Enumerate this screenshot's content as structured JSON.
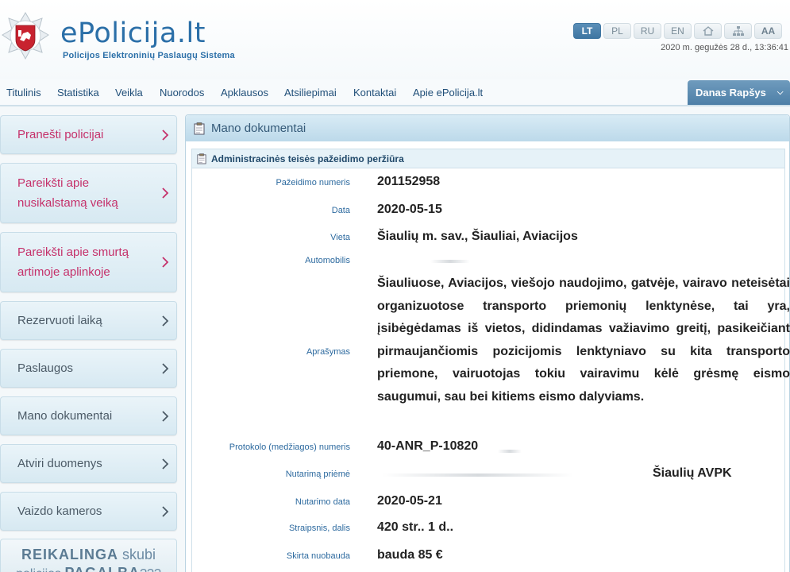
{
  "header": {
    "site_title": "ePolicija.lt",
    "site_subtitle": "Policijos Elektroninių Paslaugų Sistema",
    "languages": [
      "LT",
      "PL",
      "RU",
      "EN"
    ],
    "active_language": "LT",
    "font_size_label": "AA",
    "datetime": "2020 m. gegužės 28 d., 13:36:41"
  },
  "nav": {
    "items": [
      "Titulinis",
      "Statistika",
      "Veikla",
      "Nuorodos",
      "Apklausos",
      "Atsiliepimai",
      "Kontaktai",
      "Apie ePolicija.lt"
    ],
    "user_name": "Danas Rapšys"
  },
  "sidebar": {
    "items": [
      {
        "label_line1": "Pranešti policijai",
        "label_line2": "",
        "style": "pink"
      },
      {
        "label_line1": "Pareikšti apie",
        "label_line2": "nusikalstamą veiką",
        "style": "pink"
      },
      {
        "label_line1": "Pareikšti apie smurtą",
        "label_line2": "artimoje aplinkoje",
        "style": "pink"
      },
      {
        "label_line1": "Rezervuoti laiką",
        "label_line2": "",
        "style": "blue"
      },
      {
        "label_line1": "Paslaugos",
        "label_line2": "",
        "style": "blue"
      },
      {
        "label_line1": "Mano dokumentai",
        "label_line2": "",
        "style": "blue"
      },
      {
        "label_line1": "Atviri duomenys",
        "label_line2": "",
        "style": "blue"
      },
      {
        "label_line1": "Vaizdo kameros",
        "label_line2": "",
        "style": "blue"
      }
    ],
    "help": {
      "line1_bold": "REIKALINGA",
      "line1_rest": " skubi",
      "line2_rest": "policijos ",
      "line2_bold": "PAGALBA",
      "line2_tail": "???"
    }
  },
  "main": {
    "panel_title": "Mano dokumentai",
    "section_title": "Administracinės teisės pažeidimo peržiūra",
    "fields": {
      "violation_number": {
        "label": "Pažeidimo numeris",
        "value": "201152958"
      },
      "date": {
        "label": "Data",
        "value": "2020-05-15"
      },
      "place": {
        "label": "Vieta",
        "value": "Šiaulių m. sav., Šiauliai, Aviacijos"
      },
      "vehicle": {
        "label": "Automobilis",
        "value": ""
      },
      "description": {
        "label": "Aprašymas",
        "value": "Šiauliuose, Aviacijos, viešojo naudojimo, gatvėje, vairavo neteisėtai organizuotose transporto priemonių lenktynėse, tai yra, įsibėgėdamas iš vietos, didindamas važiavimo greitį, pasikeičiant pirmaujančiomis pozicijomis lenktyniavo su kita transporto priemone, vairuotojas tokiu vairavimu kėlė grėsmę eismo saugumui, sau bei kitiems eismo dalyviams."
      },
      "protocol_number": {
        "label": "Protokolo (medžiagos) numeris",
        "value": "40-ANR_P-10820"
      },
      "decision_maker": {
        "label": "Nutarimą priėmė",
        "value": "Šiaulių AVPK"
      },
      "decision_date": {
        "label": "Nutarimo data",
        "value": "2020-05-21"
      },
      "article": {
        "label": "Straipsnis, dalis",
        "value": "420 str.. 1 d.."
      },
      "penalty": {
        "label": "Skirta nuobauda",
        "value": "bauda 85 €"
      }
    }
  },
  "colors": {
    "brand_blue": "#2b6fa8",
    "pink_link": "#c5306a",
    "label_blue": "#2d6a9f"
  }
}
